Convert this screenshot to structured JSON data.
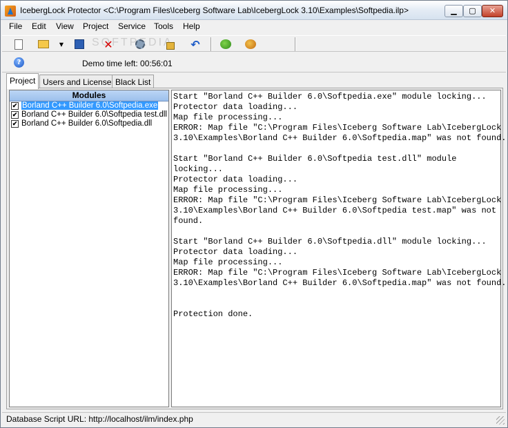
{
  "window": {
    "title": "IcebergLock Protector <C:\\Program Files\\Iceberg Software Lab\\IcebergLock 3.10\\Examples\\Softpedia.ilp>",
    "minimize": "▁",
    "maximize": "▢",
    "close": "✕"
  },
  "menu": {
    "file": "File",
    "edit": "Edit",
    "view": "View",
    "project": "Project",
    "service": "Service",
    "tools": "Tools",
    "help": "Help"
  },
  "toolbar": {
    "icons": [
      "new-icon",
      "open-folder-icon",
      "dropdown-arrow-icon",
      "save-icon",
      "delete-icon",
      "settings-icon",
      "lock-icon",
      "undo-icon",
      "network-icon",
      "network-disconnect-icon"
    ],
    "dropdown_glyph": "▼",
    "delete_glyph": "✕",
    "undo_glyph": "↶",
    "watermark": "SOFTPEDIA"
  },
  "info": {
    "help_glyph": "?",
    "demo_time": "Demo time left: 00:56:01"
  },
  "tabs": [
    {
      "label": "Project"
    },
    {
      "label": "Users and Licenses"
    },
    {
      "label": "Black List"
    }
  ],
  "modules": {
    "header": "Modules",
    "check_glyph": "✔",
    "items": [
      {
        "label": "Borland C++ Builder 6.0\\Softpedia.exe",
        "checked": true,
        "selected": true
      },
      {
        "label": "Borland C++ Builder 6.0\\Softpedia test.dll",
        "checked": true,
        "selected": false
      },
      {
        "label": "Borland C++ Builder 6.0\\Softpedia.dll",
        "checked": true,
        "selected": false
      }
    ]
  },
  "log": [
    "Start \"Borland C++ Builder 6.0\\Softpedia.exe\" module locking...",
    "Protector data loading...",
    "Map file processing...",
    "ERROR: Map file \"C:\\Program Files\\Iceberg Software Lab\\IcebergLock",
    "3.10\\Examples\\Borland C++ Builder 6.0\\Softpedia.map\" was not found.",
    "",
    "Start \"Borland C++ Builder 6.0\\Softpedia test.dll\" module",
    "locking...",
    "Protector data loading...",
    "Map file processing...",
    "ERROR: Map file \"C:\\Program Files\\Iceberg Software Lab\\IcebergLock",
    "3.10\\Examples\\Borland C++ Builder 6.0\\Softpedia test.map\" was not",
    "found.",
    "",
    "Start \"Borland C++ Builder 6.0\\Softpedia.dll\" module locking...",
    "Protector data loading...",
    "Map file processing...",
    "ERROR: Map file \"C:\\Program Files\\Iceberg Software Lab\\IcebergLock",
    "3.10\\Examples\\Borland C++ Builder 6.0\\Softpedia.map\" was not found.",
    "",
    "",
    "Protection done."
  ],
  "status": {
    "text": "Database Script URL: http://localhost/ilm/index.php"
  }
}
